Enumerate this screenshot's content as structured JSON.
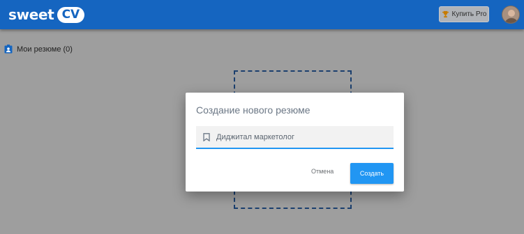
{
  "header": {
    "logo_text": "sweet",
    "logo_badge": "CV",
    "buy_pro_label": "Купить Pro"
  },
  "page": {
    "my_resumes_label": "Мои резюме (0)"
  },
  "dialog": {
    "title": "Создание нового резюме",
    "input_value": "Диджитал маркетолог",
    "cancel_label": "Отмена",
    "create_label": "Создать"
  },
  "colors": {
    "header_bg": "#1565c0",
    "accent": "#2196f3"
  },
  "icons": {
    "buy_icon": "trophy-icon",
    "resumes_icon": "badge-icon",
    "field_icon": "bookmark-icon"
  }
}
